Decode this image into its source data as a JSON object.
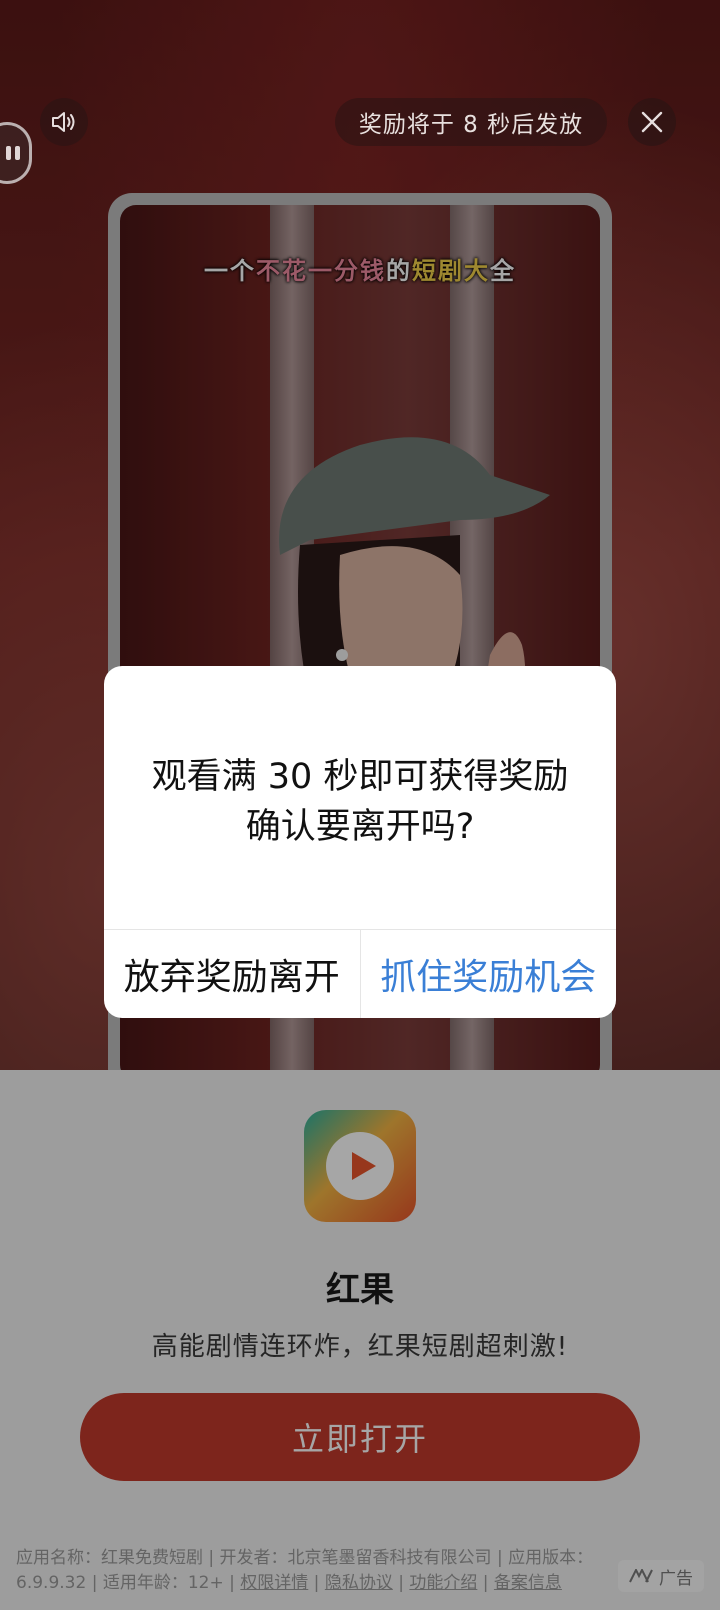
{
  "top_bar": {
    "reward_countdown": "奖励将于  8  秒后发放",
    "sound_icon": "speaker-icon",
    "close_icon": "close-icon"
  },
  "video": {
    "caption_parts": [
      {
        "text": "一个",
        "color": "white"
      },
      {
        "text": "不花一分钱",
        "color": "pink"
      },
      {
        "text": "的",
        "color": "white"
      },
      {
        "text": "短剧",
        "color": "yellow"
      },
      {
        "text": "大",
        "color": "yellow"
      },
      {
        "text": "全",
        "color": "white"
      }
    ]
  },
  "dialog": {
    "line1": "观看满 30 秒即可获得奖励",
    "line2": "确认要离开吗?",
    "leave_label": "放弃奖励离开",
    "stay_label": "抓住奖励机会"
  },
  "app": {
    "name": "红果",
    "slogan": "高能剧情连环炸，红果短剧超刺激!",
    "open_label": "立即打开",
    "info": {
      "name_label": "应用名称：红果免费短剧",
      "developer_label": "开发者：北京笔墨留香科技有限公司",
      "version_label": "应用版本：6.9.9.32",
      "age_label": "适用年龄：12+",
      "sep": " | ",
      "links": [
        "权限详情",
        "隐私协议",
        "功能介绍",
        "备案信息"
      ]
    },
    "ad_label": "广告"
  },
  "colors": {
    "accent_blue": "#3a7fd6",
    "open_button": "#c0392b"
  }
}
